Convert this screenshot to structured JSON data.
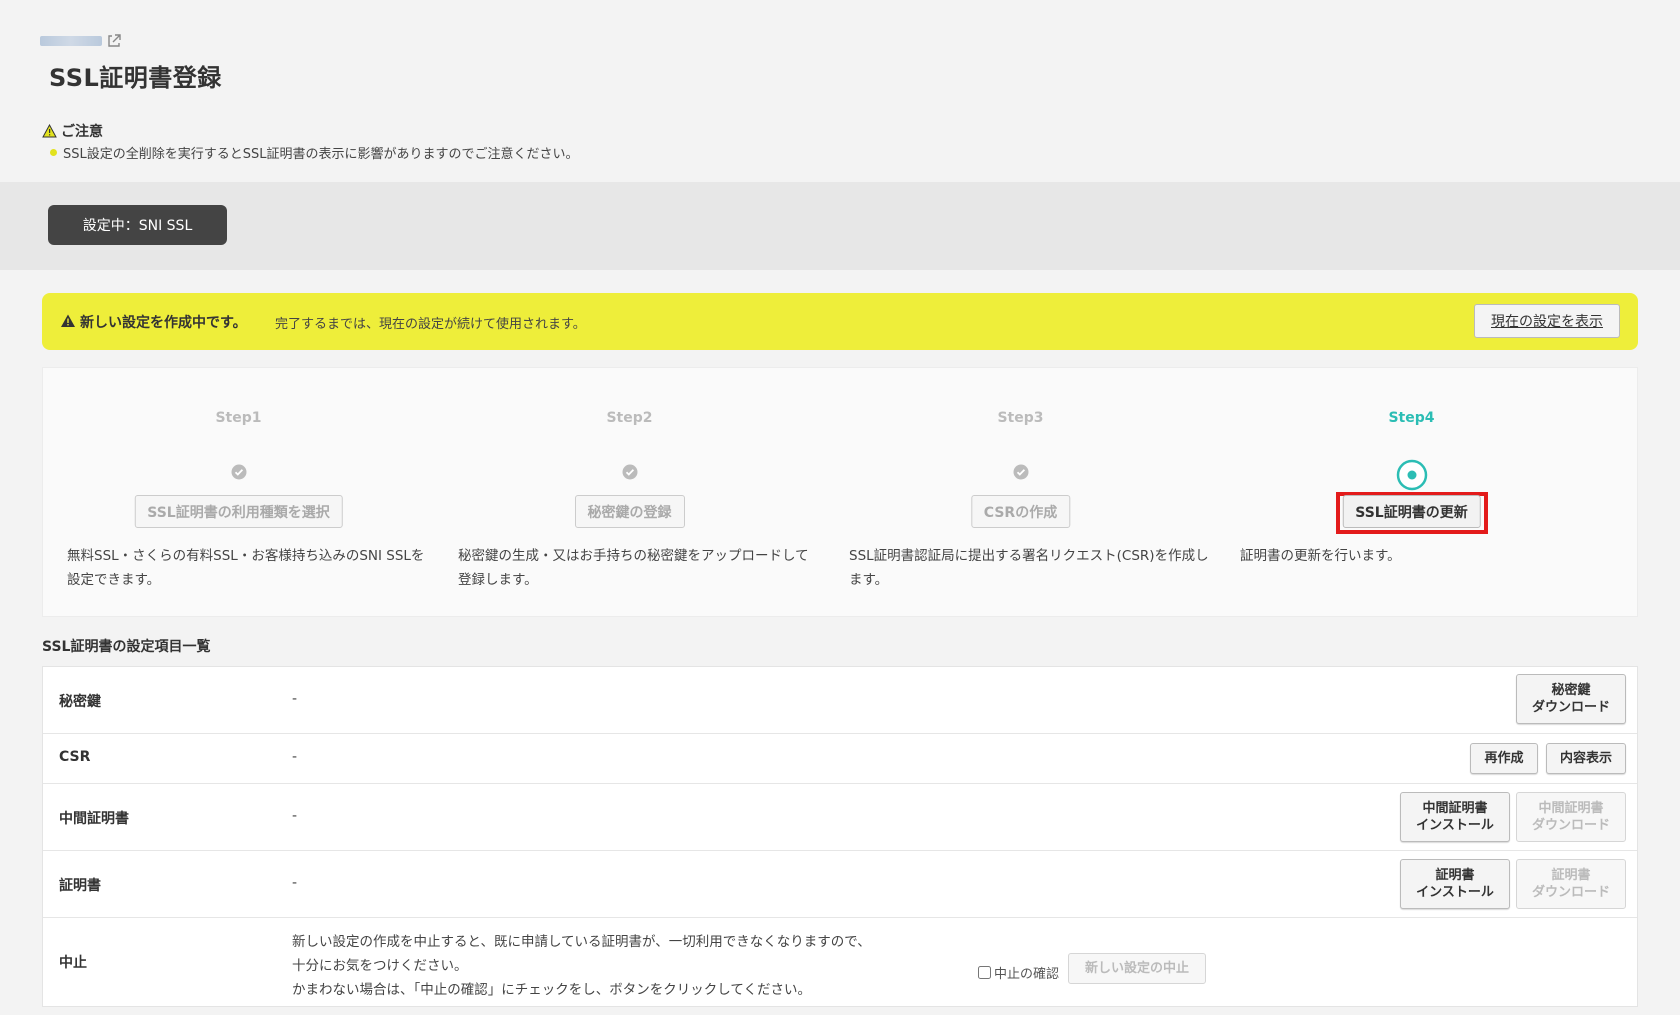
{
  "header": {
    "page_title": "SSL証明書登録"
  },
  "notice": {
    "heading": "ご注意",
    "body": "SSL設定の全削除を実行するとSSL証明書の表示に影響がありますのでご注意ください。"
  },
  "current_setting": {
    "label": "設定中：SNI SSL"
  },
  "alert": {
    "strong": "新しい設定を作成中です。",
    "text": "完了するまでは、現在の設定が続けて使用されます。",
    "button": "現在の設定を表示"
  },
  "steps": [
    {
      "label": "Step1",
      "button": "SSL証明書の利用種類を選択",
      "desc": "無料SSL・さくらの有料SSL・お客様持ち込みのSNI SSLを設定できます。",
      "status": "done"
    },
    {
      "label": "Step2",
      "button": "秘密鍵の登録",
      "desc": "秘密鍵の生成・又はお手持ちの秘密鍵をアップロードして登録します。",
      "status": "done"
    },
    {
      "label": "Step3",
      "button": "CSRの作成",
      "desc": "SSL証明書認証局に提出する署名リクエスト(CSR)を作成します。",
      "status": "done"
    },
    {
      "label": "Step4",
      "button": "SSL証明書の更新",
      "desc": "証明書の更新を行います。",
      "status": "active"
    }
  ],
  "list": {
    "title": "SSL証明書の設定項目一覧",
    "private_key": {
      "label": "秘密鍵",
      "value": "-",
      "download_line1": "秘密鍵",
      "download_line2": "ダウンロード"
    },
    "csr": {
      "label": "CSR",
      "value": "-",
      "recreate": "再作成",
      "show": "内容表示"
    },
    "intermediate": {
      "label": "中間証明書",
      "value": "-",
      "install_line1": "中間証明書",
      "install_line2": "インストール",
      "download_line1": "中間証明書",
      "download_line2": "ダウンロード"
    },
    "certificate": {
      "label": "証明書",
      "value": "-",
      "install_line1": "証明書",
      "install_line2": "インストール",
      "download_line1": "証明書",
      "download_line2": "ダウンロード"
    },
    "cancel": {
      "label": "中止",
      "line1": "新しい設定の作成を中止すると、既に申請している証明書が、一切利用できなくなりますので、",
      "line2": "十分にお気をつけください。",
      "line3": "かまわない場合は、「中止の確認」にチェックをし、ボタンをクリックしてください。",
      "confirm_label": "中止の確認",
      "button": "新しい設定の中止"
    }
  },
  "colors": {
    "accent": "#2bbdb4",
    "alert_bg": "#eeee3a",
    "highlight": "#e31b1b",
    "pill_bg": "#444444"
  }
}
